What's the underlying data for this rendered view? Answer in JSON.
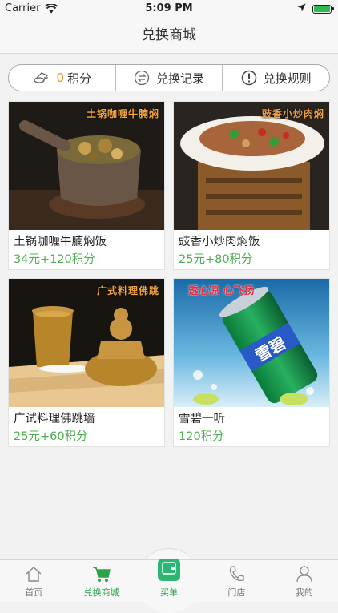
{
  "status": {
    "carrier": "Carrier",
    "time": "5:09 PM"
  },
  "nav": {
    "title": "兑换商城"
  },
  "segment": {
    "points_value": "0",
    "points_label": "积分",
    "records_label": "兑换记录",
    "rules_label": "兑换规则"
  },
  "products": [
    {
      "name": "土锅咖喱牛腩焖饭",
      "price": "34元+120积分",
      "overlay": "土锅咖喱牛腩焖"
    },
    {
      "name": "豉香小炒肉焖饭",
      "price": "25元+80积分",
      "overlay": "豉香小炒肉焖"
    },
    {
      "name": "广试料理佛跳墙",
      "price": "25元+60积分",
      "overlay": "广式料理佛跳"
    },
    {
      "name": "雪碧一听",
      "price": "120积分",
      "overlay": "透心凉 心飞扬",
      "brand": "雪碧"
    }
  ],
  "tabbar": {
    "home": "首页",
    "mall": "兑换商城",
    "pay": "买单",
    "store": "门店",
    "mine": "我的"
  },
  "colors": {
    "accent_green": "#2aa24a",
    "price_green": "#4caf50",
    "points_orange": "#f08a1c"
  }
}
